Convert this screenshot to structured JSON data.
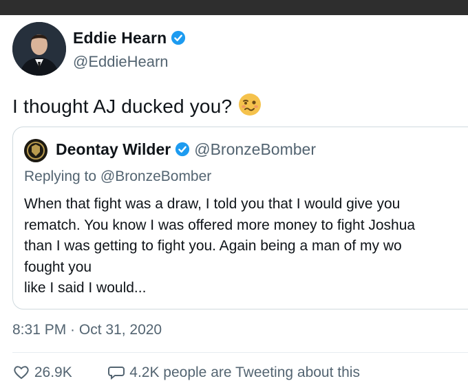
{
  "tweet": {
    "author_name": "Eddie Hearn",
    "author_handle": "@EddieHearn",
    "text": "I thought AJ ducked you?",
    "emoji_icon": "woozy-face-icon",
    "timestamp": "8:31 PM · Oct 31, 2020"
  },
  "quoted_tweet": {
    "author_name": "Deontay Wilder",
    "author_handle": "@BronzeBomber",
    "replying_to": "Replying to @BronzeBomber",
    "lines": [
      "When that fight was a draw, I told you that I would give you",
      "rematch. You know I was offered more money to fight Joshua",
      "than I was getting to fight you. Again being a man of my wo",
      "fought you",
      "like I said I would..."
    ]
  },
  "stats": {
    "likes": "26.9K",
    "tweeting": "4.2K people are Tweeting about this"
  },
  "colors": {
    "verified": "#1d9bf0",
    "secondary_text": "#536471",
    "border": "#cfd9de"
  }
}
